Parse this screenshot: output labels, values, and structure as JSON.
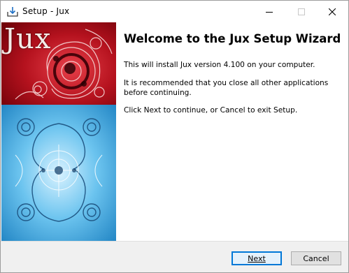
{
  "window": {
    "title": "Setup - Jux",
    "app_icon": "installer-download-icon",
    "controls": {
      "minimize": "minimize-icon",
      "maximize": "maximize-icon",
      "close": "close-icon"
    }
  },
  "banner": {
    "title": "Jux",
    "colors": {
      "top": "#b0101c",
      "bottom": "#3ba6dc"
    }
  },
  "main": {
    "heading": "Welcome to the Jux Setup Wizard",
    "paragraphs": [
      "This will install Jux version 4.100 on your computer.",
      "It is recommended that you close all other applications before continuing.",
      "Click Next to continue, or Cancel to exit Setup."
    ]
  },
  "footer": {
    "next_label": "Next",
    "cancel_label": "Cancel",
    "accent": "#0078d7"
  }
}
